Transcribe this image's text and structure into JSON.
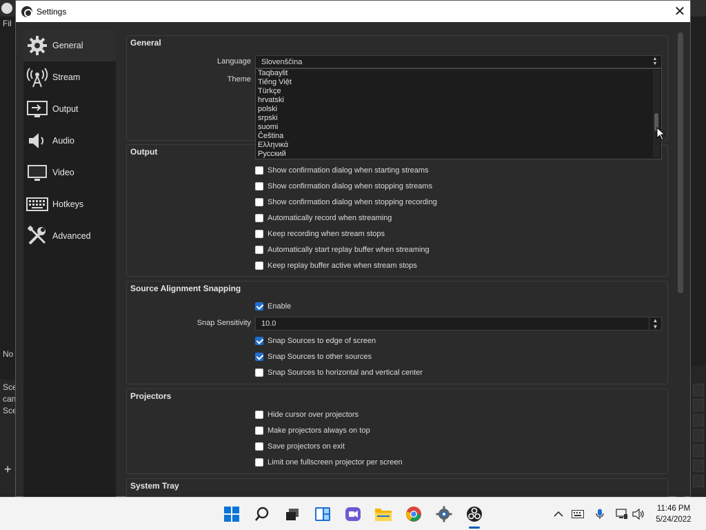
{
  "background": {
    "menu_text": "Fil",
    "left_texts": [
      "No",
      "Sce",
      "can",
      "Sce"
    ],
    "plus_label": "+"
  },
  "window": {
    "title": "Settings",
    "close_glyph": "✕"
  },
  "sidebar": {
    "items": [
      {
        "label": "General",
        "icon": "gear-icon",
        "active": true
      },
      {
        "label": "Stream",
        "icon": "broadcast-tower-icon",
        "active": false
      },
      {
        "label": "Output",
        "icon": "output-monitor-icon",
        "active": false
      },
      {
        "label": "Audio",
        "icon": "speaker-icon",
        "active": false
      },
      {
        "label": "Video",
        "icon": "monitor-icon",
        "active": false
      },
      {
        "label": "Hotkeys",
        "icon": "keyboard-icon",
        "active": false
      },
      {
        "label": "Advanced",
        "icon": "tools-icon",
        "active": false
      }
    ]
  },
  "general": {
    "title": "General",
    "language_label": "Language",
    "language_value": "Slovenščina",
    "theme_label": "Theme",
    "language_options": [
      "Taqbaylit",
      "Tiếng Việt",
      "Türkçe",
      "hrvatski",
      "polski",
      "srpski",
      "suomi",
      "Čeština",
      "Ελληνικά",
      "Русский"
    ]
  },
  "output": {
    "title": "Output",
    "checkboxes": [
      {
        "label": "Show confirmation dialog when starting streams",
        "checked": false
      },
      {
        "label": "Show confirmation dialog when stopping streams",
        "checked": false
      },
      {
        "label": "Show confirmation dialog when stopping recording",
        "checked": false
      },
      {
        "label": "Automatically record when streaming",
        "checked": false
      },
      {
        "label": "Keep recording when stream stops",
        "checked": false
      },
      {
        "label": "Automatically start replay buffer when streaming",
        "checked": false
      },
      {
        "label": "Keep replay buffer active when stream stops",
        "checked": false
      }
    ]
  },
  "snapping": {
    "title": "Source Alignment Snapping",
    "enable_label": "Enable",
    "enable_checked": true,
    "sensitivity_label": "Snap Sensitivity",
    "sensitivity_value": "10.0",
    "checkboxes": [
      {
        "label": "Snap Sources to edge of screen",
        "checked": true
      },
      {
        "label": "Snap Sources to other sources",
        "checked": true
      },
      {
        "label": "Snap Sources to horizontal and vertical center",
        "checked": false
      }
    ]
  },
  "projectors": {
    "title": "Projectors",
    "checkboxes": [
      {
        "label": "Hide cursor over projectors",
        "checked": false
      },
      {
        "label": "Make projectors always on top",
        "checked": false
      },
      {
        "label": "Save projectors on exit",
        "checked": false
      },
      {
        "label": "Limit one fullscreen projector per screen",
        "checked": false
      }
    ]
  },
  "system_tray": {
    "title": "System Tray"
  },
  "taskbar": {
    "apps": [
      "start-icon",
      "search-icon",
      "task-view-icon",
      "widgets-icon",
      "chat-icon",
      "file-explorer-icon",
      "chrome-icon",
      "settings-icon",
      "obs-icon"
    ],
    "tray": [
      "chevron-up-icon",
      "keyboard-icon",
      "microphone-icon",
      "network-icon",
      "volume-icon"
    ],
    "time": "11:46 PM",
    "date": "5/24/2022"
  }
}
